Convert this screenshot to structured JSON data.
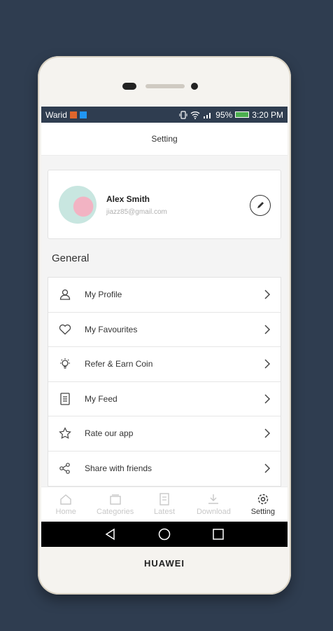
{
  "status_bar": {
    "carrier": "Warid",
    "battery": "95%",
    "time": "3:20 PM",
    "colors": {
      "bar": "#2f3d50",
      "icon_orange": "#e0662c",
      "icon_blue": "#2196f3",
      "battery_fill": "#4caf50"
    }
  },
  "header": {
    "title": "Setting"
  },
  "profile": {
    "name": "Alex Smith",
    "email": "jiazz85@gmail.com",
    "avatar_icon": "avatar-image",
    "edit_icon": "pencil-icon"
  },
  "section": {
    "title": "General"
  },
  "menu": [
    {
      "label": "My Profile",
      "icon": "user-icon"
    },
    {
      "label": "My Favourites",
      "icon": "heart-icon"
    },
    {
      "label": "Refer & Earn Coin",
      "icon": "bulb-icon"
    },
    {
      "label": "My Feed",
      "icon": "feed-icon"
    },
    {
      "label": "Rate our app",
      "icon": "star-icon"
    },
    {
      "label": "Share with friends",
      "icon": "share-icon"
    }
  ],
  "bottom_nav": [
    {
      "label": "Home",
      "icon": "home-icon",
      "active": false
    },
    {
      "label": "Categories",
      "icon": "categories-icon",
      "active": false
    },
    {
      "label": "Latest",
      "icon": "latest-icon",
      "active": false
    },
    {
      "label": "Download",
      "icon": "download-icon",
      "active": false
    },
    {
      "label": "Setting",
      "icon": "gear-icon",
      "active": true
    }
  ],
  "device": {
    "brand": "HUAWEI",
    "background": "#2f3d50"
  }
}
